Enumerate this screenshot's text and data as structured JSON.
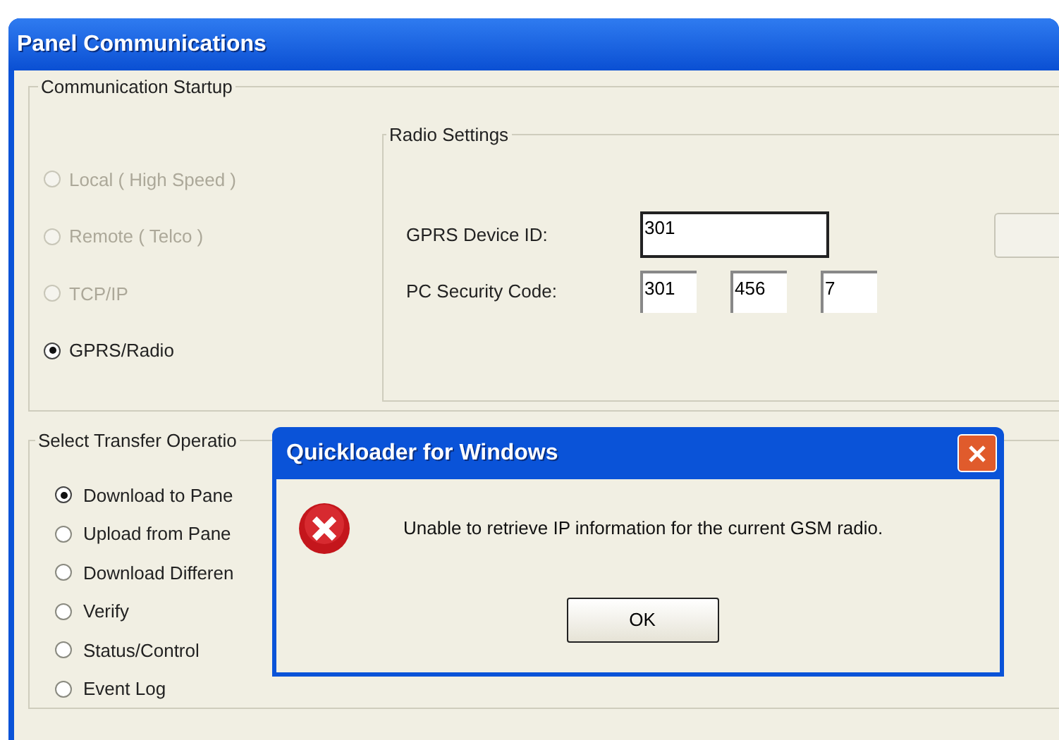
{
  "window": {
    "title": "Panel Communications"
  },
  "communication_startup": {
    "title": "Communication Startup",
    "options": [
      {
        "label": "Local ( High Speed )",
        "selected": false,
        "disabled": true
      },
      {
        "label": "Remote ( Telco )",
        "selected": false,
        "disabled": true
      },
      {
        "label": "TCP/IP",
        "selected": false,
        "disabled": true
      },
      {
        "label": "GPRS/Radio",
        "selected": true,
        "disabled": false
      }
    ]
  },
  "radio_settings": {
    "title": "Radio Settings",
    "device_id_label": "GPRS Device ID:",
    "device_id": "301",
    "security_code_label": "PC Security Code:",
    "security_code": [
      "301",
      "456",
      "7"
    ]
  },
  "transfer_operation": {
    "title": "Select Transfer Operatio",
    "options": [
      {
        "label": "Download to Pane",
        "selected": true
      },
      {
        "label": "Upload from Pane",
        "selected": false
      },
      {
        "label": "Download Differen",
        "selected": false
      },
      {
        "label": "Verify",
        "selected": false
      },
      {
        "label": "Status/Control",
        "selected": false
      },
      {
        "label": "Event Log",
        "selected": false
      }
    ]
  },
  "dialog": {
    "title": "Quickloader for Windows",
    "message": "Unable to retrieve IP information for the current GSM radio.",
    "button": "OK"
  }
}
